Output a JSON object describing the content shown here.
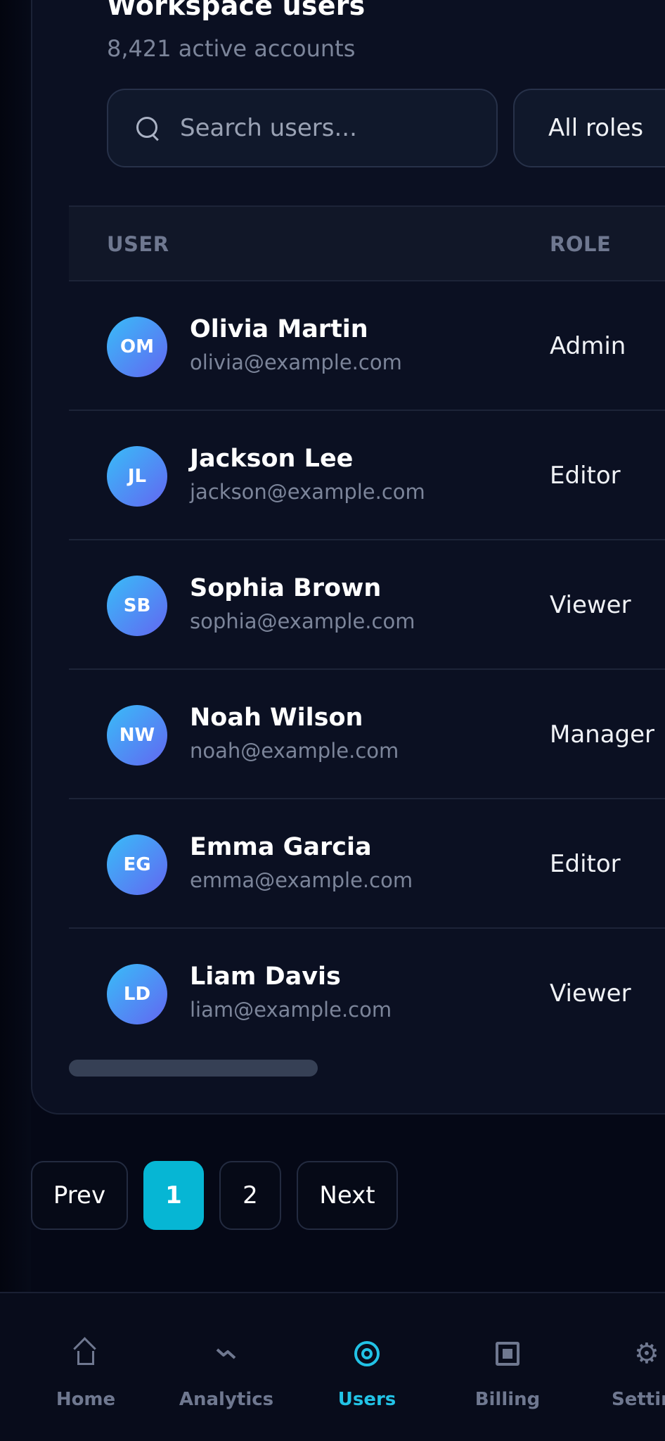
{
  "header": {
    "title": "Workspace users",
    "subtitle": "8,421 active accounts"
  },
  "search": {
    "placeholder": "Search users..."
  },
  "filter": {
    "role_selected": "All roles"
  },
  "table": {
    "columns": [
      "USER",
      "ROLE"
    ],
    "rows": [
      {
        "initials": "OM",
        "name": "Olivia Martin",
        "email": "olivia@example.com",
        "role": "Admin"
      },
      {
        "initials": "JL",
        "name": "Jackson Lee",
        "email": "jackson@example.com",
        "role": "Editor"
      },
      {
        "initials": "SB",
        "name": "Sophia Brown",
        "email": "sophia@example.com",
        "role": "Viewer"
      },
      {
        "initials": "NW",
        "name": "Noah Wilson",
        "email": "noah@example.com",
        "role": "Manager"
      },
      {
        "initials": "EG",
        "name": "Emma Garcia",
        "email": "emma@example.com",
        "role": "Editor"
      },
      {
        "initials": "LD",
        "name": "Liam Davis",
        "email": "liam@example.com",
        "role": "Viewer"
      }
    ]
  },
  "pagination": {
    "prev": "Prev",
    "pages": [
      "1",
      "2"
    ],
    "current": "1",
    "next": "Next"
  },
  "nav": {
    "items": [
      {
        "label": "Home",
        "icon": "home-icon"
      },
      {
        "label": "Analytics",
        "icon": "analytics-icon"
      },
      {
        "label": "Users",
        "icon": "users-icon",
        "active": true
      },
      {
        "label": "Billing",
        "icon": "billing-icon"
      },
      {
        "label": "Settings",
        "icon": "settings-icon"
      }
    ]
  },
  "colors": {
    "accent": "#06b6d4",
    "background": "#050816",
    "card": "#0b1022"
  }
}
